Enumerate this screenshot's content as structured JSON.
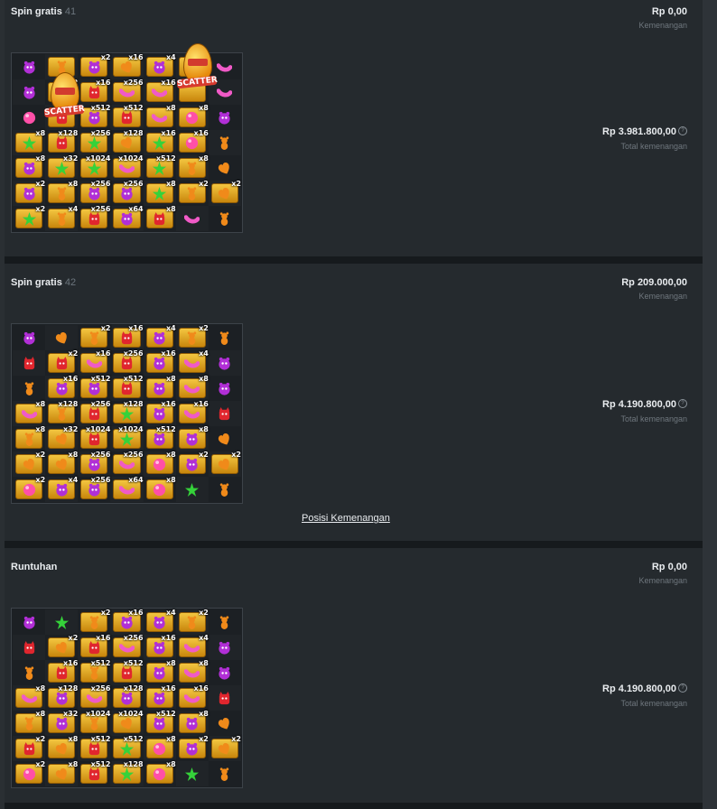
{
  "colors": {
    "purple": "#b12fd6",
    "red": "#e0262e",
    "orange": "#f08a1a",
    "pink": "#ff4fa8",
    "green": "#35d23a",
    "magenta": "#f05ac7",
    "gold": "#f2b52a"
  },
  "icons": {
    "P": "purple-monster-icon",
    "R": "red-devil-icon",
    "O": "orange-bear-icon",
    "H": "orange-heart-candy-icon",
    "K": "pink-round-candy-icon",
    "S": "green-star-candy-icon",
    "B": "pink-bean-candy-icon"
  },
  "panels": [
    {
      "title": "Spin gratis",
      "number": "41",
      "amount": "Rp 0,00",
      "amount_label": "Kemenangan",
      "total": "Rp 3.981.800,00",
      "total_label": "Total kemenangan",
      "help": "?",
      "scatter_label": "SCATTER",
      "grid": [
        [
          "P",
          "O*",
          "P*x2",
          "H*x16",
          "P*x4",
          "*x2",
          "B"
        ],
        [
          "P",
          "*x2",
          "R*x16",
          "B*x256",
          "B*x16",
          "*x4",
          "B"
        ],
        [
          "K",
          "R*x16",
          "P*x512",
          "R*x512",
          "B*x8",
          "K*x8",
          "P"
        ],
        [
          "S*x8",
          "R*x128",
          "S*x256",
          "H*x128",
          "S*x16",
          "K*x16",
          "O"
        ],
        [
          "P*x8",
          "S*x32",
          "S*x1024",
          "B*x1024",
          "S*x512",
          "O*x8",
          "H"
        ],
        [
          "P*x2",
          "O*x8",
          "P*x256",
          "P*x256",
          "S*x8",
          "O*x2",
          "H*x2"
        ],
        [
          "S*x2",
          "O*x4",
          "R*x256",
          "P*x64",
          "R*x8",
          "B",
          "O"
        ]
      ]
    },
    {
      "title": "Spin gratis",
      "number": "42",
      "amount": "Rp 209.000,00",
      "amount_label": "Kemenangan",
      "total": "Rp 4.190.800,00",
      "total_label": "Total kemenangan",
      "help": "?",
      "link": "Posisi Kemenangan",
      "grid": [
        [
          "P",
          "H",
          "O*x2",
          "R*x16",
          "P*x4",
          "O*x2",
          "O"
        ],
        [
          "R",
          "R*x2",
          "B*x16",
          "R*x256",
          "P*x16",
          "B*x4",
          "P"
        ],
        [
          "O",
          "P*x16",
          "P*x512",
          "R*x512",
          "P*x8",
          "B*x8",
          "P"
        ],
        [
          "B*x8",
          "O*x128",
          "R*x256",
          "S*x128",
          "P*x16",
          "B*x16",
          "R"
        ],
        [
          "O*x8",
          "H*x32",
          "R*x1024",
          "S*x1024",
          "P*x512",
          "P*x8",
          "H"
        ],
        [
          "H*x2",
          "H*x8",
          "P*x256",
          "B*x256",
          "K*x8",
          "P*x2",
          "H*x2"
        ],
        [
          "K*x2",
          "P*x4",
          "P*x256",
          "B*x64",
          "K*x8",
          "S",
          "O"
        ]
      ]
    },
    {
      "title": "Runtuhan",
      "number": "",
      "amount": "Rp 0,00",
      "amount_label": "Kemenangan",
      "total": "Rp 4.190.800,00",
      "total_label": "Total kemenangan",
      "help": "?",
      "grid": [
        [
          "P",
          "S",
          "O*x2",
          "P*x16",
          "P*x4",
          "O*x2",
          "O"
        ],
        [
          "R",
          "H*x2",
          "R*x16",
          "B*x256",
          "P*x16",
          "B*x4",
          "P"
        ],
        [
          "O",
          "R*x16",
          "O*x512",
          "R*x512",
          "P*x8",
          "B*x8",
          "P"
        ],
        [
          "B*x8",
          "P*x128",
          "B*x256",
          "P*x128",
          "P*x16",
          "B*x16",
          "R"
        ],
        [
          "O*x8",
          "P*x32",
          "O*x1024",
          "H*x1024",
          "P*x512",
          "P*x8",
          "H"
        ],
        [
          "R*x2",
          "H*x8",
          "R*x512",
          "S*x512",
          "K*x8",
          "P*x2",
          "H*x2"
        ],
        [
          "K*x2",
          "H*x8",
          "R*x512",
          "S*x128",
          "K*x8",
          "S",
          "O"
        ]
      ]
    }
  ]
}
